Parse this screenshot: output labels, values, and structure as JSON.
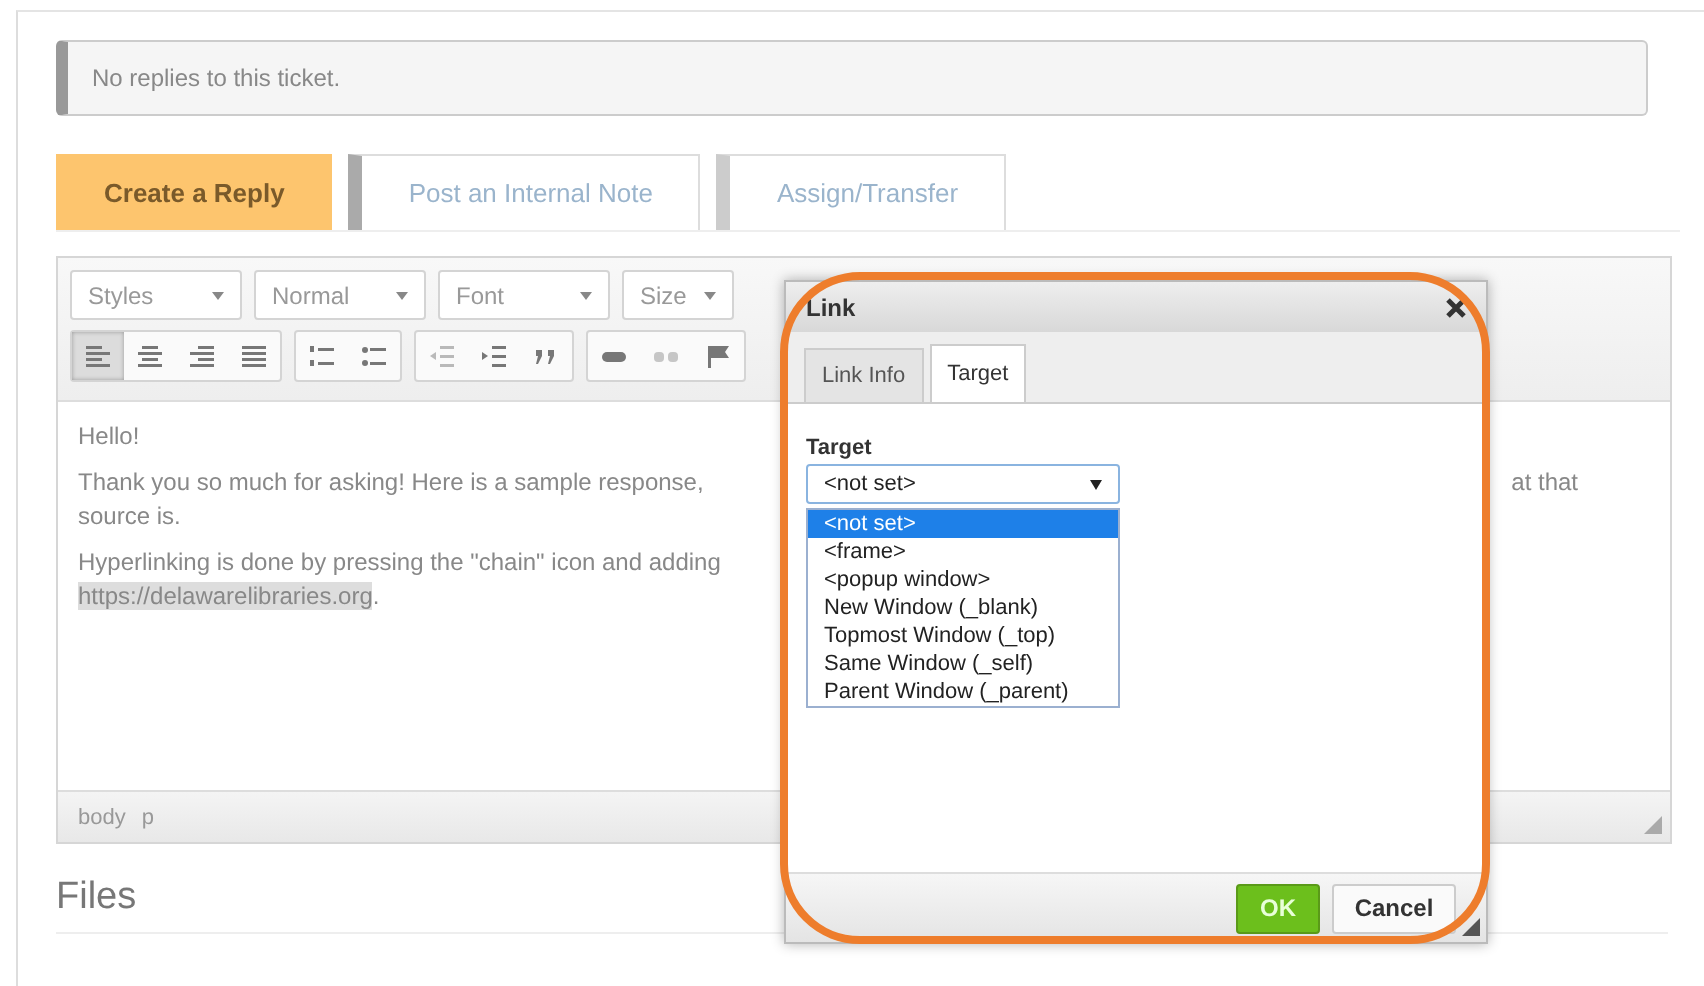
{
  "notice": "No replies to this ticket.",
  "tabs": [
    {
      "label": "Create a Reply",
      "selected": true
    },
    {
      "label": "Post an Internal Note",
      "selected": false
    },
    {
      "label": "Assign/Transfer",
      "selected": false
    }
  ],
  "toolbar_dropdowns": [
    "Styles",
    "Normal",
    "Font",
    "Size"
  ],
  "toolbar_buttons": [
    {
      "kind": "align-left",
      "selected": true
    },
    {
      "kind": "align-center",
      "selected": false
    },
    {
      "kind": "align-right",
      "selected": false
    },
    {
      "kind": "justify",
      "selected": false
    },
    {
      "kind": "numbered-list",
      "selected": false
    },
    {
      "kind": "bullet-list",
      "selected": false
    },
    {
      "kind": "outdent",
      "selected": false
    },
    {
      "kind": "indent",
      "selected": false
    },
    {
      "kind": "quote",
      "selected": false
    },
    {
      "kind": "link",
      "selected": false
    },
    {
      "kind": "unlink",
      "selected": false
    },
    {
      "kind": "flag",
      "selected": false
    }
  ],
  "editor": {
    "greeting": "Hello!",
    "paragraph_start": "Thank you so much for asking! Here is a sample response,",
    "paragraph_end": "at that",
    "paragraph_line2": "source is.",
    "hyperlink_sentence": "Hyperlinking is done by pressing the \"chain\" icon and adding",
    "link": "https://delawarelibraries.org",
    "link_after": "."
  },
  "status_path": [
    "body",
    "p"
  ],
  "files_heading": "Files",
  "dialog": {
    "title": "Link",
    "tabs": [
      {
        "label": "Link Info",
        "selected": false
      },
      {
        "label": "Target",
        "selected": true
      }
    ],
    "field_label": "Target",
    "select_value": "<not set>",
    "options": [
      {
        "label": "<not set>",
        "selected": true
      },
      {
        "label": "<frame>",
        "selected": false
      },
      {
        "label": "<popup window>",
        "selected": false
      },
      {
        "label": "New Window (_blank)",
        "selected": false
      },
      {
        "label": "Topmost Window (_top)",
        "selected": false
      },
      {
        "label": "Same Window (_self)",
        "selected": false
      },
      {
        "label": "Parent Window (_parent)",
        "selected": false
      }
    ],
    "ok": "OK",
    "cancel": "Cancel"
  }
}
